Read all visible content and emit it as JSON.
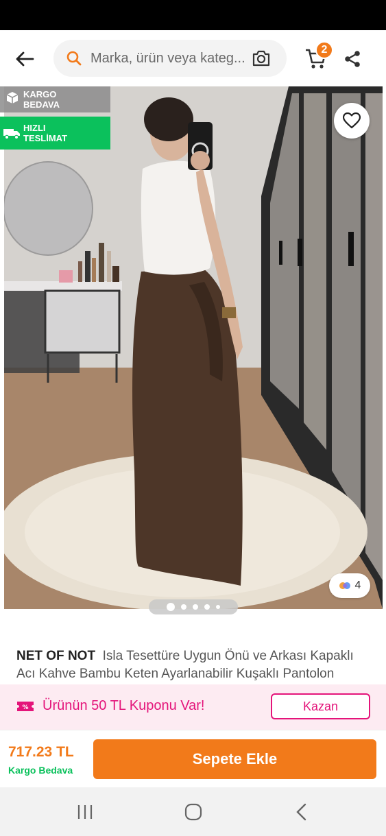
{
  "search": {
    "placeholder": "Marka, ürün veya kateg..."
  },
  "cart": {
    "badge_count": "2"
  },
  "badges": {
    "kargo_line1": "KARGO",
    "kargo_line2": "BEDAVA",
    "hizli_line1": "HIZLI",
    "hizli_line2": "TESLİMAT"
  },
  "gallery": {
    "photo_count": "4",
    "total_dots": 5,
    "active_dot": 1
  },
  "product": {
    "brand": "NET OF NOT",
    "title": "Isla Tesettüre Uygun Önü ve Arkası Kapaklı Acı Kahve Bambu Keten Ayarlanabilir Kuşaklı Pantolon"
  },
  "coupon": {
    "text": "Ürünün 50 TL Kuponu Var!",
    "button_label": "Kazan"
  },
  "purchase": {
    "price": "717.23 TL",
    "shipping": "Kargo Bedava",
    "add_to_cart_label": "Sepete Ekle"
  },
  "colors": {
    "brand_orange": "#f27a1a",
    "fast_delivery_green": "#0bc15c",
    "coupon_pink": "#e4147a",
    "coupon_bg": "#fdebf2"
  },
  "icons": {
    "back": "arrow-left-icon",
    "search": "search-icon",
    "camera": "camera-icon",
    "cart": "cart-icon",
    "share": "share-icon",
    "favorite": "heart-icon",
    "photo_count": "gallery-dots-icon",
    "kargo": "box-icon",
    "hizli": "truck-icon",
    "coupon": "ticket-icon",
    "nav_recents": "recents-icon",
    "nav_home": "home-icon",
    "nav_back": "nav-back-icon"
  }
}
